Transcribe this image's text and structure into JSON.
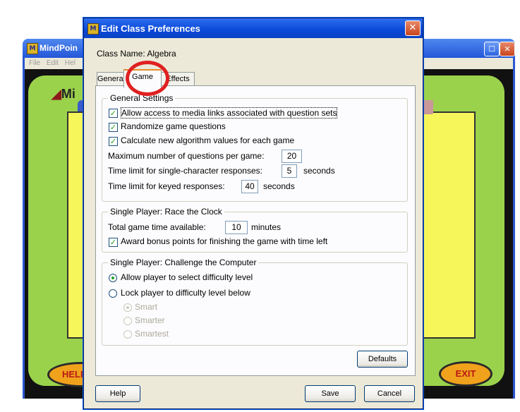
{
  "background_app": {
    "title": "MindPoin",
    "menu": [
      "File",
      "Edit",
      "Hel"
    ],
    "logo_fragment": "Mi",
    "help_label": "HELP",
    "exit_label": "EXIT"
  },
  "dialog": {
    "title": "Edit Class Preferences",
    "class_name_label": "Class Name:",
    "class_name_value": "Algebra",
    "tabs": [
      {
        "label": "General",
        "selected": false
      },
      {
        "label": "Game",
        "selected": true
      },
      {
        "label": "Effects",
        "selected": false
      }
    ],
    "general_settings": {
      "title": "General Settings",
      "checkboxes": [
        {
          "label": "Allow access to media links associated with question sets",
          "checked": true
        },
        {
          "label": "Randomize game questions",
          "checked": true
        },
        {
          "label": "Calculate new algorithm values for each game",
          "checked": true
        }
      ],
      "max_questions_label": "Maximum number of questions per game:",
      "max_questions_value": "20",
      "single_char_label": "Time limit for single-character responses:",
      "single_char_value": "5",
      "single_char_unit": "seconds",
      "keyed_label": "Time limit for keyed responses:",
      "keyed_value": "40",
      "keyed_unit": "seconds"
    },
    "race_clock": {
      "title": "Single Player: Race the Clock",
      "total_time_label": "Total game time available:",
      "total_time_value": "10",
      "total_time_unit": "minutes",
      "bonus_label": "Award bonus points for finishing the game with time left",
      "bonus_checked": true
    },
    "challenge_computer": {
      "title": "Single Player: Challenge the Computer",
      "options": [
        {
          "label": "Allow player to select difficulty level",
          "selected": true
        },
        {
          "label": "Lock player to difficulty level below",
          "selected": false
        }
      ],
      "levels": [
        {
          "label": "Smart",
          "selected": true
        },
        {
          "label": "Smarter",
          "selected": false
        },
        {
          "label": "Smartest",
          "selected": false
        }
      ]
    },
    "buttons": {
      "defaults": "Defaults",
      "help": "Help",
      "save": "Save",
      "cancel": "Cancel"
    }
  },
  "colors": {
    "annotation": "#e02020",
    "xp_titlebar": "#0a48d8",
    "dialog_face": "#ece9d8"
  }
}
